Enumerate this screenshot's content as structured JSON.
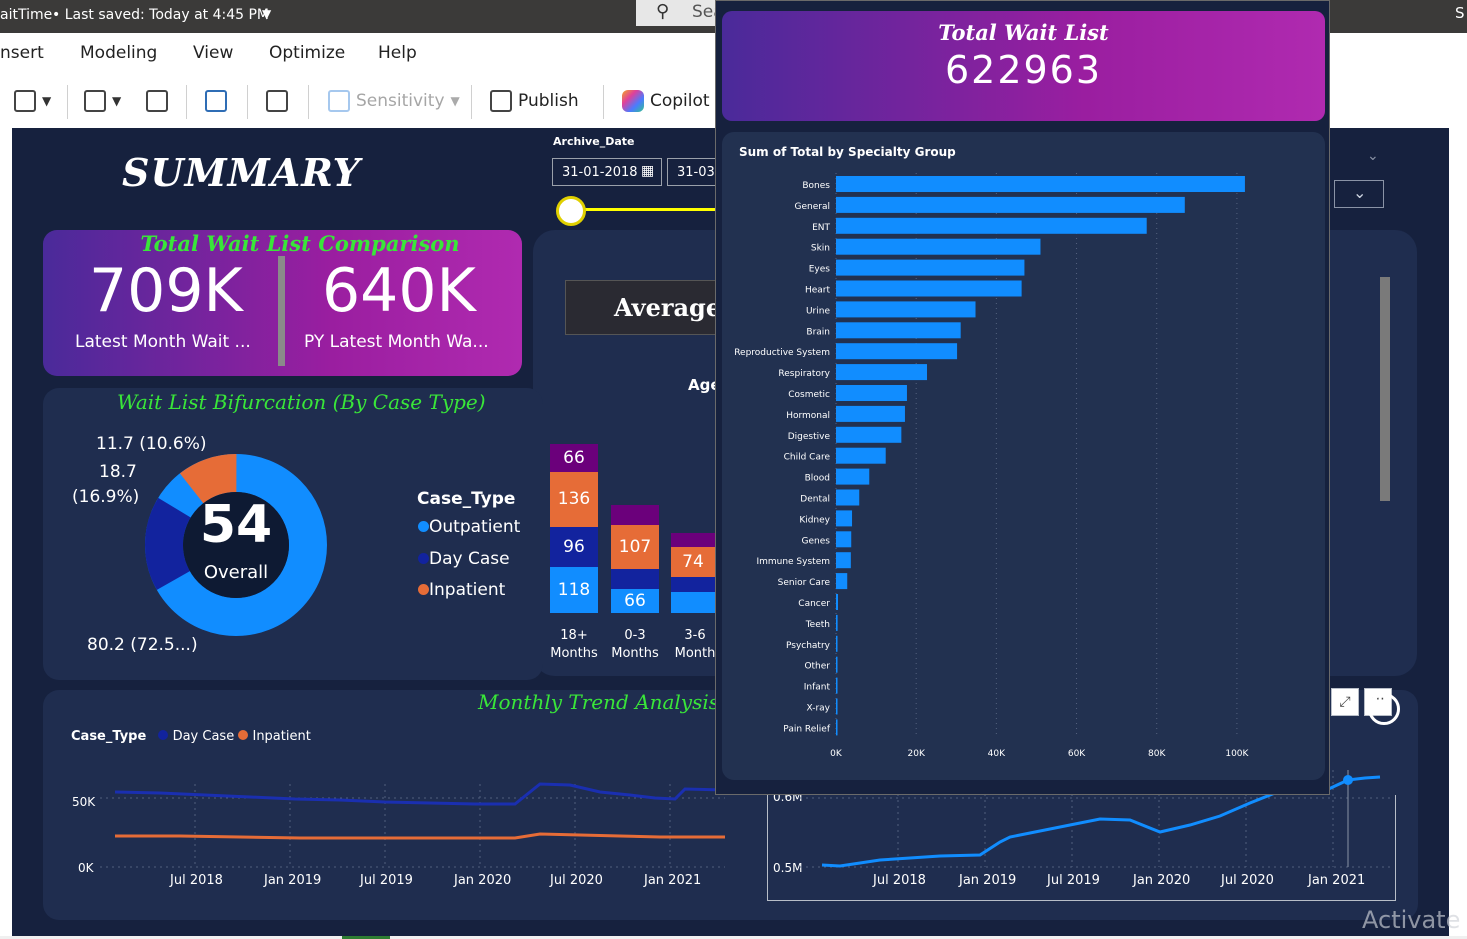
{
  "titlebar": {
    "title": "aitTime",
    "saved": "•  Last saved: Today at 4:45 PM",
    "search_placeholder": "Sea"
  },
  "menu": [
    "nsert",
    "Modeling",
    "View",
    "Optimize",
    "Help"
  ],
  "toolbar": {
    "sensitivity": "Sensitivity",
    "publish": "Publish",
    "copilot": "Copilot"
  },
  "summary": {
    "title": "SUMMARY"
  },
  "comparison": {
    "title": "Total Wait List Comparison",
    "latest_value": "709K",
    "latest_label": "Latest Month Wait ...",
    "py_value": "640K",
    "py_label": "PY Latest Month Wa..."
  },
  "bifurcation": {
    "title": "Wait List Bifurcation (By Case Type)",
    "center_value": "54",
    "center_label": "Overall",
    "label_a": "11.7 (10.6%)",
    "label_b1": "18.7",
    "label_b2": "(16.9%)",
    "label_c": "80.2 (72.5...)",
    "legend_title": "Case_Type",
    "legend": [
      "Outpatient",
      "Day Case",
      "Inpatient"
    ]
  },
  "filters": {
    "archive_label": "Archive_Date",
    "start_date": "31-01-2018",
    "end_date": "31-03-"
  },
  "average": {
    "label": "Average",
    "age_label": "Age"
  },
  "stacked": {
    "columns": [
      {
        "label1": "18+",
        "label2": "Months",
        "outpatient": "118",
        "daycase": "96",
        "inpatient": "136",
        "top": "66"
      },
      {
        "label1": "0-3",
        "label2": "Months",
        "outpatient": "66",
        "daycase": "",
        "inpatient": "107",
        "top": ""
      },
      {
        "label1": "3-6",
        "label2": "Month",
        "outpatient": "",
        "daycase": "",
        "inpatient": "74",
        "top": ""
      }
    ]
  },
  "trend": {
    "title": "Monthly Trend Analysis -",
    "legend_title": "Case_Type",
    "legend": [
      "Day Case",
      "Inpatient"
    ],
    "left_yticks": [
      "50K",
      "0K"
    ],
    "right_yticks": [
      "0.6M",
      "0.5M"
    ],
    "xticks": [
      "Jul 2018",
      "Jan 2019",
      "Jul 2019",
      "Jan 2020",
      "Jul 2020",
      "Jan 2021"
    ]
  },
  "tooltip": {
    "title": "Total Wait List",
    "value": "622963"
  },
  "chart_data": {
    "type": "bar",
    "title": "Sum of Total by Specialty Group",
    "orientation": "horizontal",
    "categories": [
      "Bones",
      "General",
      "ENT",
      "Skin",
      "Eyes",
      "Heart",
      "Urine",
      "Brain",
      "Reproductive System",
      "Respiratory",
      "Cosmetic",
      "Hormonal",
      "Digestive",
      "Child Care",
      "Blood",
      "Dental",
      "Kidney",
      "Genes",
      "Immune System",
      "Senior Care",
      "Cancer",
      "Teeth",
      "Psychatry",
      "Other",
      "Infant",
      "X-ray",
      "Pain Relief"
    ],
    "values": [
      102000,
      87000,
      77500,
      51000,
      47000,
      46300,
      34800,
      31100,
      30200,
      22700,
      17700,
      17200,
      16300,
      12400,
      8300,
      5800,
      4000,
      3800,
      3700,
      2800,
      500,
      400,
      300,
      250,
      200,
      150,
      100
    ],
    "xlim": [
      0,
      110000
    ],
    "xticks": [
      "0K",
      "20K",
      "40K",
      "60K",
      "80K",
      "100K"
    ],
    "grid": true,
    "colors": {
      "bar": "#118dff"
    }
  },
  "watermark": "Activate V",
  "colors": {
    "canvas": "#16213e",
    "panel": "#1f2d4f",
    "accent_green": "#39e639",
    "outpatient": "#118dff",
    "daycase": "#12239e",
    "inpatient": "#e66c37",
    "top": "#6b007b"
  }
}
